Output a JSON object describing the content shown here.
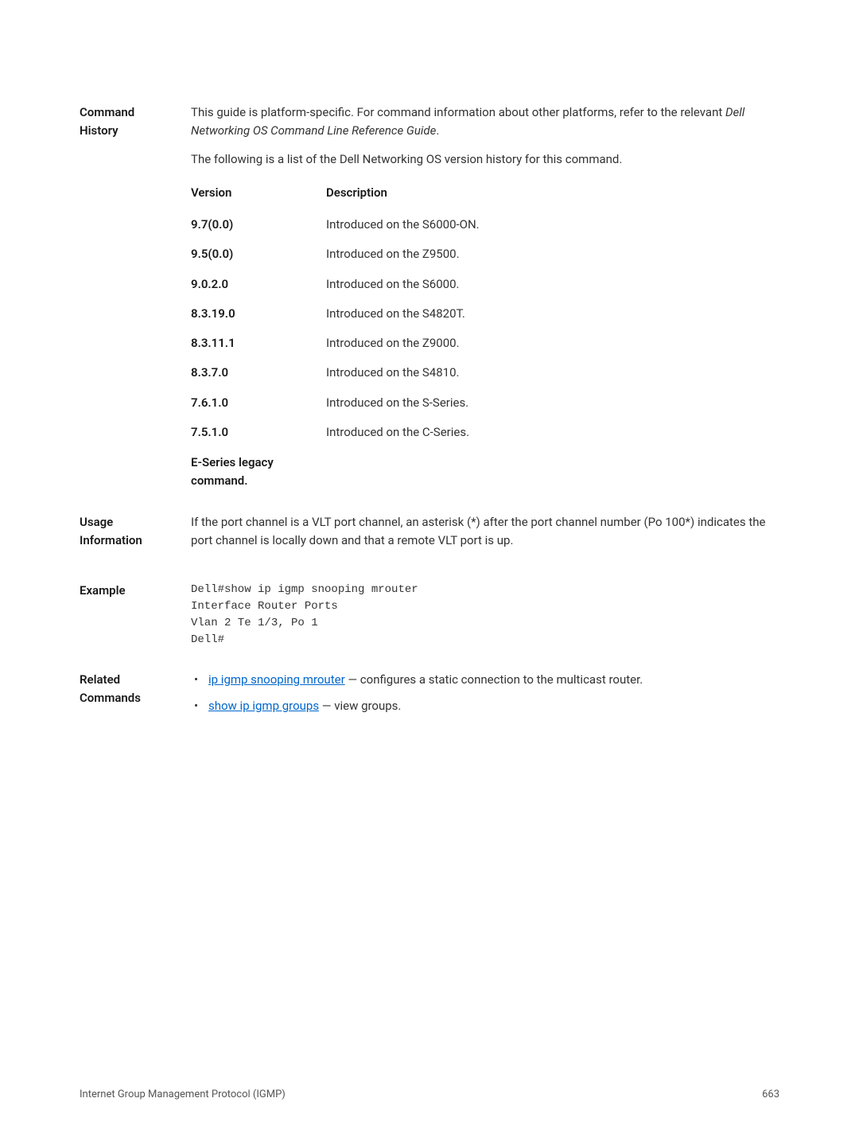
{
  "sections": {
    "command_history": {
      "label": "Command History",
      "para1_a": "This guide is platform-specific. For command information about other platforms, refer to the relevant ",
      "para1_italic": "Dell Networking OS Command Line Reference Guide",
      "para1_b": ".",
      "para2": "The following is a list of the Dell Networking OS version history for this command.",
      "table": {
        "header_version": "Version",
        "header_description": "Description",
        "rows": [
          {
            "version": "9.7(0.0)",
            "description": "Introduced on the S6000-ON."
          },
          {
            "version": "9.5(0.0)",
            "description": "Introduced on the Z9500."
          },
          {
            "version": "9.0.2.0",
            "description": "Introduced on the S6000."
          },
          {
            "version": "8.3.19.0",
            "description": "Introduced on the S4820T."
          },
          {
            "version": "8.3.11.1",
            "description": "Introduced on the Z9000."
          },
          {
            "version": "8.3.7.0",
            "description": "Introduced on the S4810."
          },
          {
            "version": "7.6.1.0",
            "description": "Introduced on the S-Series."
          },
          {
            "version": "7.5.1.0",
            "description": "Introduced on the C-Series."
          }
        ],
        "footer_text": "E-Series legacy command."
      }
    },
    "usage_information": {
      "label": "Usage Information",
      "text": "If the port channel is a VLT port channel, an asterisk (*) after the port channel number (Po 100*) indicates the port channel is locally down and that a remote VLT port is up."
    },
    "example": {
      "label": "Example",
      "code": "Dell#show ip igmp snooping mrouter\nInterface Router Ports\nVlan 2 Te 1/3, Po 1\nDell#"
    },
    "related_commands": {
      "label": "Related Commands",
      "items": [
        {
          "link": "ip igmp snooping mrouter",
          "rest": " — configures a static connection to the multicast router."
        },
        {
          "link": "show ip igmp groups",
          "rest": " — view groups."
        }
      ]
    }
  },
  "footer": {
    "title": "Internet Group Management Protocol (IGMP)",
    "page": "663"
  }
}
